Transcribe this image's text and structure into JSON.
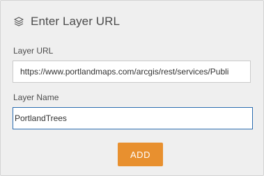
{
  "dialog": {
    "title": "Enter Layer URL",
    "icon": "layers-icon"
  },
  "layer_url": {
    "label": "Layer URL",
    "value": "https://www.portlandmaps.com/arcgis/rest/services/Publi"
  },
  "layer_name": {
    "label": "Layer Name",
    "value": "PortlandTrees"
  },
  "actions": {
    "add_label": "ADD"
  },
  "colors": {
    "panel_background": "#efefef",
    "accent": "#e8902f",
    "focus_border": "#2b6cb0",
    "text": "#4c4c4c"
  }
}
